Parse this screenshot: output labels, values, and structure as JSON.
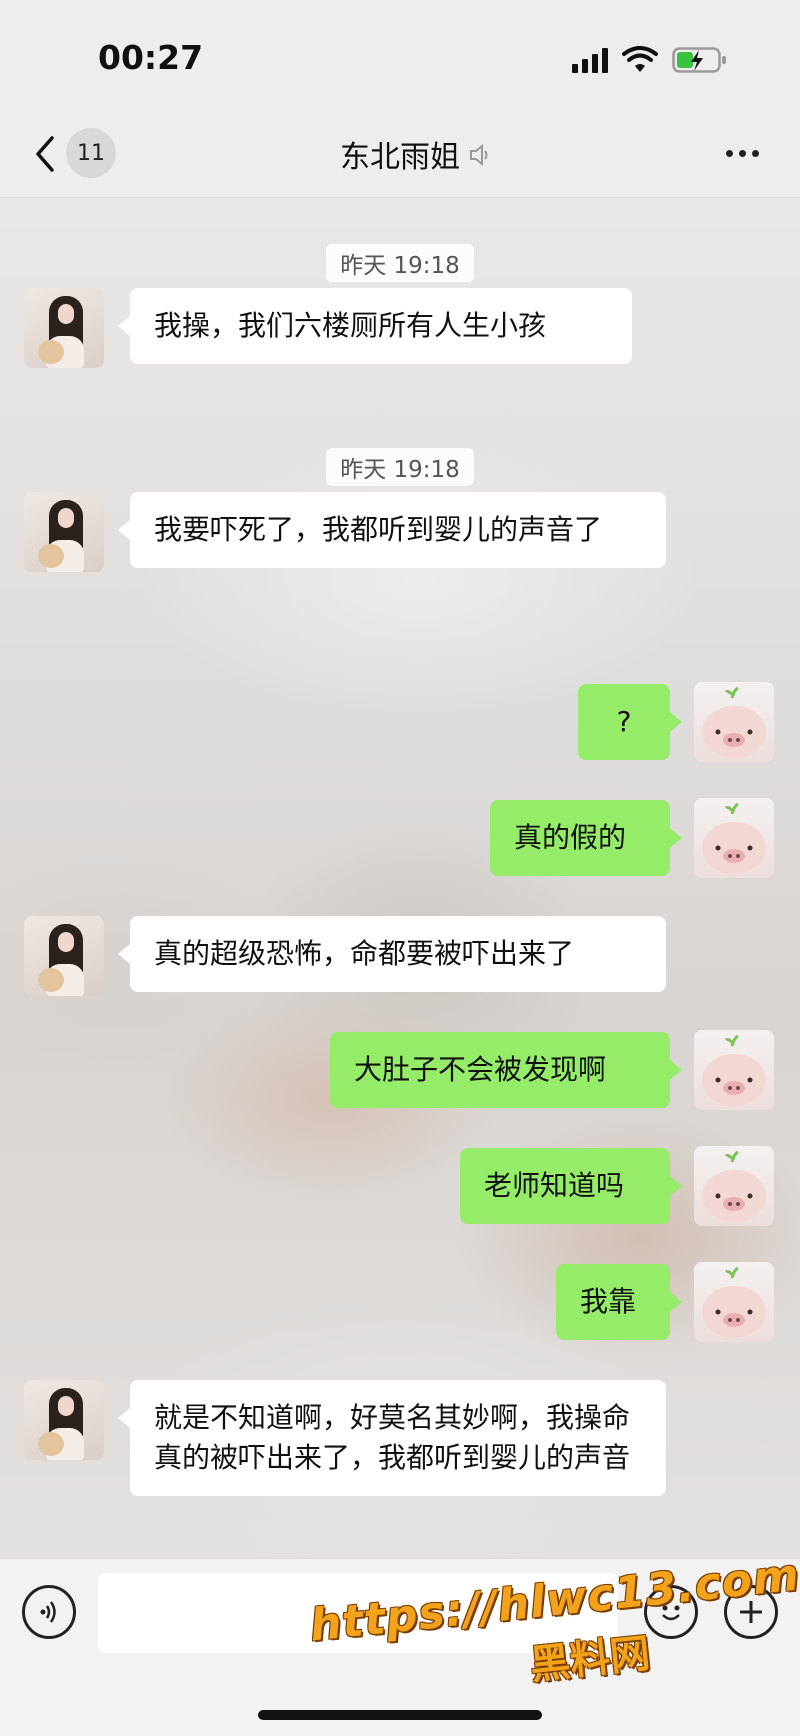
{
  "status_bar": {
    "time": "00:27"
  },
  "nav": {
    "unread_count": "11",
    "title": "东北雨姐",
    "icons": {
      "back": "chevron-left-icon",
      "mute": "sound-off-icon",
      "more": "more-dots-icon"
    }
  },
  "messages": [
    {
      "type": "time",
      "text": "昨天 19:18"
    },
    {
      "type": "in",
      "text": "我操，我们六楼厕所有人生小孩"
    },
    {
      "type": "time",
      "text": "昨天 19:18"
    },
    {
      "type": "in",
      "text": "我要吓死了，我都听到婴儿的声音了"
    },
    {
      "type": "out",
      "text": "?"
    },
    {
      "type": "out",
      "text": "真的假的"
    },
    {
      "type": "in",
      "text": "真的超级恐怖，命都要被吓出来了"
    },
    {
      "type": "out",
      "text": "大肚子不会被发现啊"
    },
    {
      "type": "out",
      "text": "老师知道吗"
    },
    {
      "type": "out",
      "text": "我靠"
    },
    {
      "type": "in",
      "text": "就是不知道啊，好莫名其妙啊，我操命真的被吓出来了，我都听到婴儿的声音"
    }
  ],
  "input_bar": {
    "value": "",
    "icons": {
      "voice": "voice-icon",
      "emoji": "emoji-icon",
      "plus": "plus-icon"
    }
  },
  "watermark": {
    "url": "https://hlwc13.com",
    "site": "黑料网"
  },
  "colors": {
    "outgoing_bubble": "#95ec69",
    "incoming_bubble": "#ffffff",
    "bar_background": "#ededed"
  }
}
